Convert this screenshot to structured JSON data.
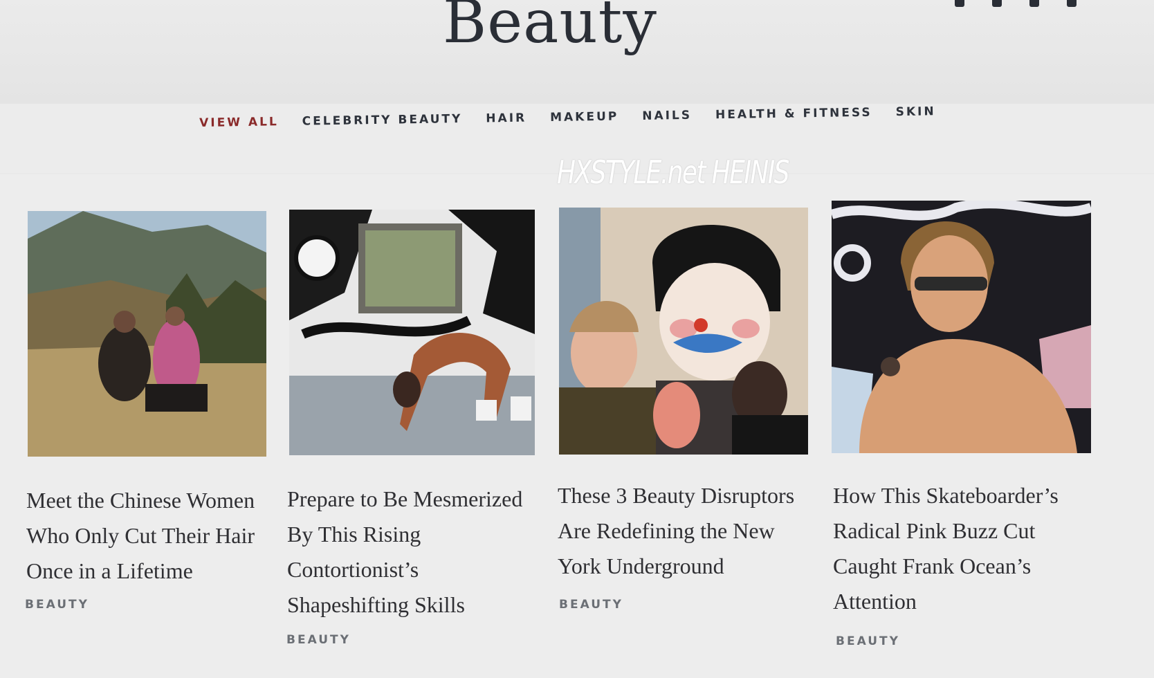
{
  "header": {
    "title": "Beauty",
    "social_icons": [
      "facebook-icon",
      "pinterest-icon",
      "twitter-icon",
      "email-icon"
    ]
  },
  "nav": {
    "items": [
      {
        "label": "VIEW ALL",
        "active": true
      },
      {
        "label": "CELEBRITY BEAUTY",
        "active": false
      },
      {
        "label": "HAIR",
        "active": false
      },
      {
        "label": "MAKEUP",
        "active": false
      },
      {
        "label": "NAILS",
        "active": false
      },
      {
        "label": "HEALTH & FITNESS",
        "active": false
      },
      {
        "label": "SKIN",
        "active": false
      }
    ],
    "active_color": "#8a2a2a"
  },
  "watermark": "HXSTYLE.net HEINIS",
  "articles": [
    {
      "title": "Meet the Chinese Women Who Only Cut Their Hair Once in a Lifetime",
      "category": "BEAUTY",
      "image": "photo of two women seated on a hillside"
    },
    {
      "title": "Prepare to Be Mesmerized By This Rising Contortionist’s Shapeshifting Skills",
      "category": "BEAUTY",
      "image": "photo of contortionist bending in front of graffiti mural"
    },
    {
      "title": "These 3 Beauty Disruptors Are Redefining the New York Underground",
      "category": "BEAUTY",
      "image": "collage of three people with painted clown face behind"
    },
    {
      "title": "How This Skateboarder’s Radical Pink Buzz Cut Caught Frank Ocean’s Attention",
      "category": "BEAUTY",
      "image": "photo of shirtless young man in sunglasses"
    }
  ]
}
